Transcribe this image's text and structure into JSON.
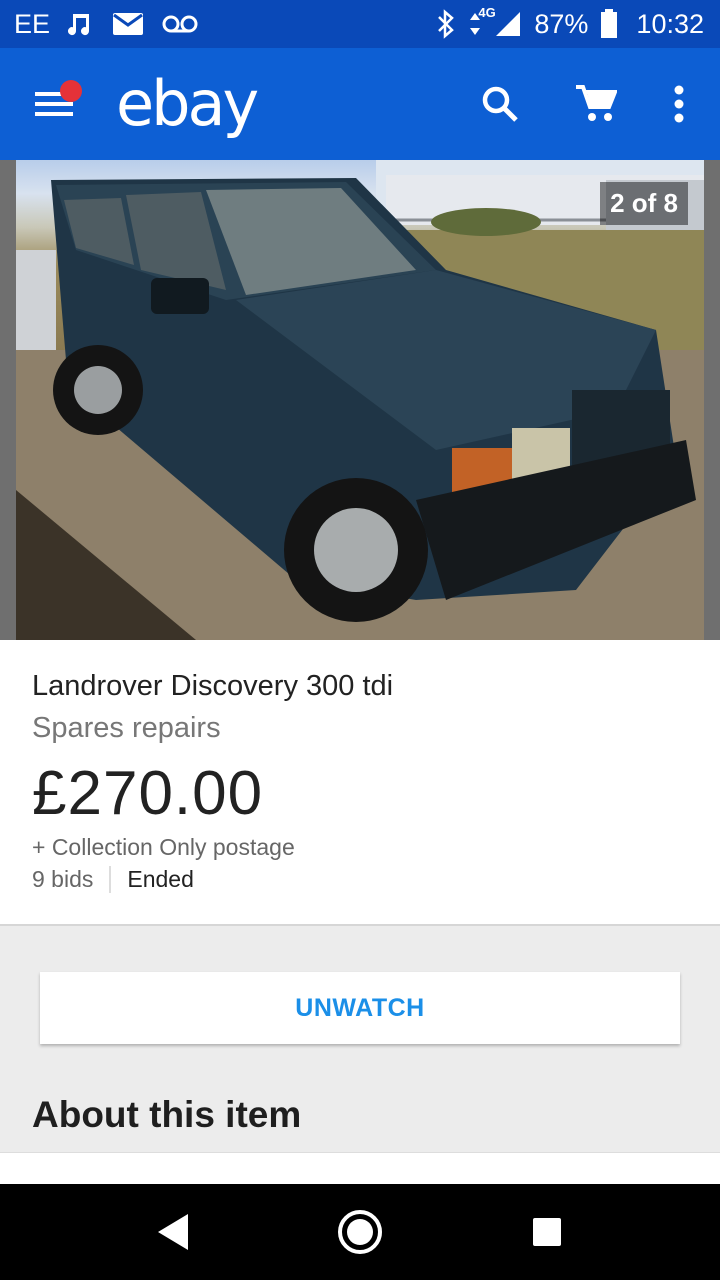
{
  "status_bar": {
    "carrier": "EE",
    "network": "4G",
    "battery": "87%",
    "time": "10:32",
    "icons": [
      "music-note-icon",
      "mail-icon",
      "voicemail-icon",
      "bluetooth-icon",
      "data-arrows-icon",
      "signal-icon",
      "battery-icon"
    ]
  },
  "app_bar": {
    "logo": "ebay",
    "icons": [
      "menu-icon",
      "search-icon",
      "cart-icon",
      "overflow-menu-icon"
    ],
    "notification_color": "#e53238",
    "background": "#0d5fd4"
  },
  "gallery": {
    "counter": "2 of 8"
  },
  "item": {
    "title": "Landrover Discovery 300 tdi",
    "subtitle": "Spares repairs",
    "price": "£270.00",
    "postage": "+ Collection Only postage",
    "bids": "9 bids",
    "status": "Ended"
  },
  "actions": {
    "unwatch_label": "UNWATCH",
    "accent": "#1b8fe8"
  },
  "about": {
    "title": "About this item"
  },
  "nav_bar": {
    "icons": [
      "back-icon",
      "home-icon",
      "recents-icon"
    ]
  }
}
